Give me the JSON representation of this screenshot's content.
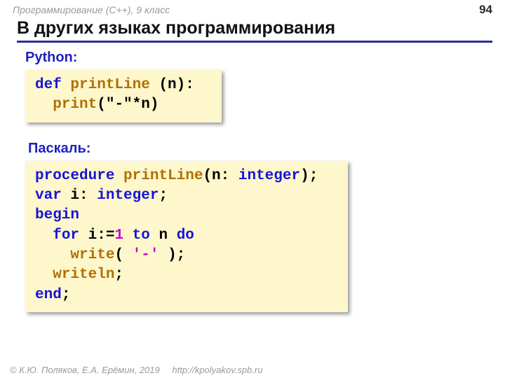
{
  "header": {
    "course": "Программирование (C++), 9 класс",
    "page_number": "94"
  },
  "title": "В других языках программирования",
  "python": {
    "label": "Python:",
    "code": {
      "kw_def": "def",
      "fn_name": "printLine",
      "params": " (n):",
      "indent": "  ",
      "call_print": "print",
      "args": "(\"-\"*n)"
    }
  },
  "pascal": {
    "label": "Паскаль:",
    "code": {
      "kw_procedure": "procedure",
      "sp": " ",
      "fn_name": "printLine",
      "open_paren": "(n: ",
      "type_integer": "integer",
      "close_paren": ");",
      "kw_var": "var",
      "var_decl": " i: ",
      "type_integer2": "integer",
      "semi": ";",
      "kw_begin": "begin",
      "indent2": "  ",
      "kw_for": "for",
      "for_txt": " i:=",
      "num_one": "1",
      "for_rest": " ",
      "kw_to": "to",
      "to_rest": " n ",
      "kw_do": "do",
      "indent4": "    ",
      "call_write": "write",
      "write_open": "( ",
      "dash_str": "'-'",
      "write_close": " );",
      "call_writeln": "writeln",
      "writeln_semi": ";",
      "kw_end": "end",
      "end_semi": ";"
    }
  },
  "footer": {
    "authors": "© К.Ю. Поляков, Е.А. Ерёмин, 2019",
    "url": "http://kpolyakov.spb.ru"
  }
}
